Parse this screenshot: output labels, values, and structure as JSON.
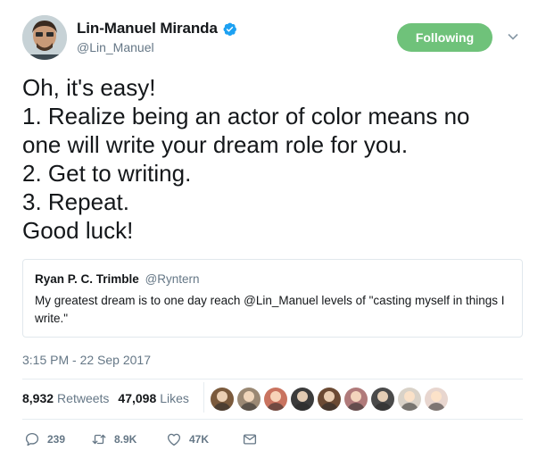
{
  "author": {
    "display_name": "Lin-Manuel Miranda",
    "handle": "@Lin_Manuel",
    "verified": true
  },
  "follow_button": {
    "label": "Following"
  },
  "tweet": {
    "lines": [
      "Oh, it's easy!",
      "1. Realize being an actor of color means no",
      "one will write your dream role for you.",
      "2. Get to writing.",
      "3. Repeat.",
      "Good luck!"
    ],
    "timestamp": "3:15 PM - 22 Sep 2017"
  },
  "quoted_tweet": {
    "display_name": "Ryan P. C. Trimble",
    "handle": "@Ryntern",
    "text": "My greatest dream is to one day reach @Lin_Manuel levels of \"casting myself in things I write.\""
  },
  "stats": {
    "retweets_count": "8,932",
    "retweets_label": "Retweets",
    "likes_count": "47,098",
    "likes_label": "Likes"
  },
  "likers": [
    {
      "name": "liker-1",
      "bg": "#7b5a3c"
    },
    {
      "name": "liker-2",
      "bg": "#9a8873"
    },
    {
      "name": "liker-3",
      "bg": "#c9735f"
    },
    {
      "name": "liker-4",
      "bg": "#3b3b3b"
    },
    {
      "name": "liker-5",
      "bg": "#6b4a33"
    },
    {
      "name": "liker-6",
      "bg": "#b07a7a"
    },
    {
      "name": "liker-7",
      "bg": "#4a4a4a"
    },
    {
      "name": "liker-8",
      "bg": "#d9d2c8"
    },
    {
      "name": "liker-9",
      "bg": "#e8d6cf"
    }
  ],
  "actions": {
    "reply_count": "239",
    "retweet_count": "8.9K",
    "like_count": "47K"
  },
  "colors": {
    "accent_following": "#6fc27a",
    "verified_blue": "#1da1f2",
    "secondary_text": "#657786"
  }
}
